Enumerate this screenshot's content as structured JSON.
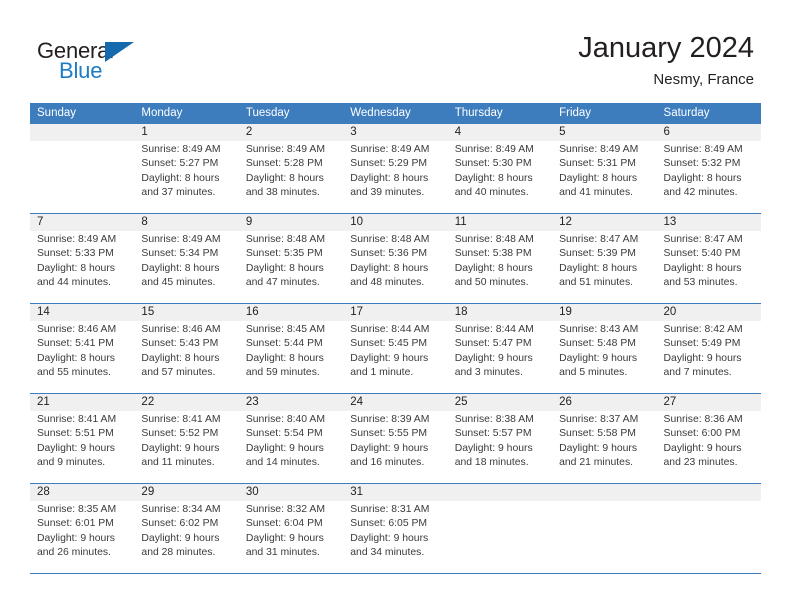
{
  "brand": {
    "word_general": "General",
    "word_blue": "Blue"
  },
  "header": {
    "title": "January 2024",
    "location": "Nesmy, France"
  },
  "calendar": {
    "day_headers": [
      "Sunday",
      "Monday",
      "Tuesday",
      "Wednesday",
      "Thursday",
      "Friday",
      "Saturday"
    ],
    "accent_color": "#3d7dbe",
    "daynum_band_color": "#f0f0f0",
    "weeks": [
      [
        {
          "day": "",
          "lines": []
        },
        {
          "day": "1",
          "lines": [
            "Sunrise: 8:49 AM",
            "Sunset: 5:27 PM",
            "Daylight: 8 hours",
            "and 37 minutes."
          ]
        },
        {
          "day": "2",
          "lines": [
            "Sunrise: 8:49 AM",
            "Sunset: 5:28 PM",
            "Daylight: 8 hours",
            "and 38 minutes."
          ]
        },
        {
          "day": "3",
          "lines": [
            "Sunrise: 8:49 AM",
            "Sunset: 5:29 PM",
            "Daylight: 8 hours",
            "and 39 minutes."
          ]
        },
        {
          "day": "4",
          "lines": [
            "Sunrise: 8:49 AM",
            "Sunset: 5:30 PM",
            "Daylight: 8 hours",
            "and 40 minutes."
          ]
        },
        {
          "day": "5",
          "lines": [
            "Sunrise: 8:49 AM",
            "Sunset: 5:31 PM",
            "Daylight: 8 hours",
            "and 41 minutes."
          ]
        },
        {
          "day": "6",
          "lines": [
            "Sunrise: 8:49 AM",
            "Sunset: 5:32 PM",
            "Daylight: 8 hours",
            "and 42 minutes."
          ]
        }
      ],
      [
        {
          "day": "7",
          "lines": [
            "Sunrise: 8:49 AM",
            "Sunset: 5:33 PM",
            "Daylight: 8 hours",
            "and 44 minutes."
          ]
        },
        {
          "day": "8",
          "lines": [
            "Sunrise: 8:49 AM",
            "Sunset: 5:34 PM",
            "Daylight: 8 hours",
            "and 45 minutes."
          ]
        },
        {
          "day": "9",
          "lines": [
            "Sunrise: 8:48 AM",
            "Sunset: 5:35 PM",
            "Daylight: 8 hours",
            "and 47 minutes."
          ]
        },
        {
          "day": "10",
          "lines": [
            "Sunrise: 8:48 AM",
            "Sunset: 5:36 PM",
            "Daylight: 8 hours",
            "and 48 minutes."
          ]
        },
        {
          "day": "11",
          "lines": [
            "Sunrise: 8:48 AM",
            "Sunset: 5:38 PM",
            "Daylight: 8 hours",
            "and 50 minutes."
          ]
        },
        {
          "day": "12",
          "lines": [
            "Sunrise: 8:47 AM",
            "Sunset: 5:39 PM",
            "Daylight: 8 hours",
            "and 51 minutes."
          ]
        },
        {
          "day": "13",
          "lines": [
            "Sunrise: 8:47 AM",
            "Sunset: 5:40 PM",
            "Daylight: 8 hours",
            "and 53 minutes."
          ]
        }
      ],
      [
        {
          "day": "14",
          "lines": [
            "Sunrise: 8:46 AM",
            "Sunset: 5:41 PM",
            "Daylight: 8 hours",
            "and 55 minutes."
          ]
        },
        {
          "day": "15",
          "lines": [
            "Sunrise: 8:46 AM",
            "Sunset: 5:43 PM",
            "Daylight: 8 hours",
            "and 57 minutes."
          ]
        },
        {
          "day": "16",
          "lines": [
            "Sunrise: 8:45 AM",
            "Sunset: 5:44 PM",
            "Daylight: 8 hours",
            "and 59 minutes."
          ]
        },
        {
          "day": "17",
          "lines": [
            "Sunrise: 8:44 AM",
            "Sunset: 5:45 PM",
            "Daylight: 9 hours",
            "and 1 minute."
          ]
        },
        {
          "day": "18",
          "lines": [
            "Sunrise: 8:44 AM",
            "Sunset: 5:47 PM",
            "Daylight: 9 hours",
            "and 3 minutes."
          ]
        },
        {
          "day": "19",
          "lines": [
            "Sunrise: 8:43 AM",
            "Sunset: 5:48 PM",
            "Daylight: 9 hours",
            "and 5 minutes."
          ]
        },
        {
          "day": "20",
          "lines": [
            "Sunrise: 8:42 AM",
            "Sunset: 5:49 PM",
            "Daylight: 9 hours",
            "and 7 minutes."
          ]
        }
      ],
      [
        {
          "day": "21",
          "lines": [
            "Sunrise: 8:41 AM",
            "Sunset: 5:51 PM",
            "Daylight: 9 hours",
            "and 9 minutes."
          ]
        },
        {
          "day": "22",
          "lines": [
            "Sunrise: 8:41 AM",
            "Sunset: 5:52 PM",
            "Daylight: 9 hours",
            "and 11 minutes."
          ]
        },
        {
          "day": "23",
          "lines": [
            "Sunrise: 8:40 AM",
            "Sunset: 5:54 PM",
            "Daylight: 9 hours",
            "and 14 minutes."
          ]
        },
        {
          "day": "24",
          "lines": [
            "Sunrise: 8:39 AM",
            "Sunset: 5:55 PM",
            "Daylight: 9 hours",
            "and 16 minutes."
          ]
        },
        {
          "day": "25",
          "lines": [
            "Sunrise: 8:38 AM",
            "Sunset: 5:57 PM",
            "Daylight: 9 hours",
            "and 18 minutes."
          ]
        },
        {
          "day": "26",
          "lines": [
            "Sunrise: 8:37 AM",
            "Sunset: 5:58 PM",
            "Daylight: 9 hours",
            "and 21 minutes."
          ]
        },
        {
          "day": "27",
          "lines": [
            "Sunrise: 8:36 AM",
            "Sunset: 6:00 PM",
            "Daylight: 9 hours",
            "and 23 minutes."
          ]
        }
      ],
      [
        {
          "day": "28",
          "lines": [
            "Sunrise: 8:35 AM",
            "Sunset: 6:01 PM",
            "Daylight: 9 hours",
            "and 26 minutes."
          ]
        },
        {
          "day": "29",
          "lines": [
            "Sunrise: 8:34 AM",
            "Sunset: 6:02 PM",
            "Daylight: 9 hours",
            "and 28 minutes."
          ]
        },
        {
          "day": "30",
          "lines": [
            "Sunrise: 8:32 AM",
            "Sunset: 6:04 PM",
            "Daylight: 9 hours",
            "and 31 minutes."
          ]
        },
        {
          "day": "31",
          "lines": [
            "Sunrise: 8:31 AM",
            "Sunset: 6:05 PM",
            "Daylight: 9 hours",
            "and 34 minutes."
          ]
        },
        {
          "day": "",
          "lines": []
        },
        {
          "day": "",
          "lines": []
        },
        {
          "day": "",
          "lines": []
        }
      ]
    ]
  }
}
